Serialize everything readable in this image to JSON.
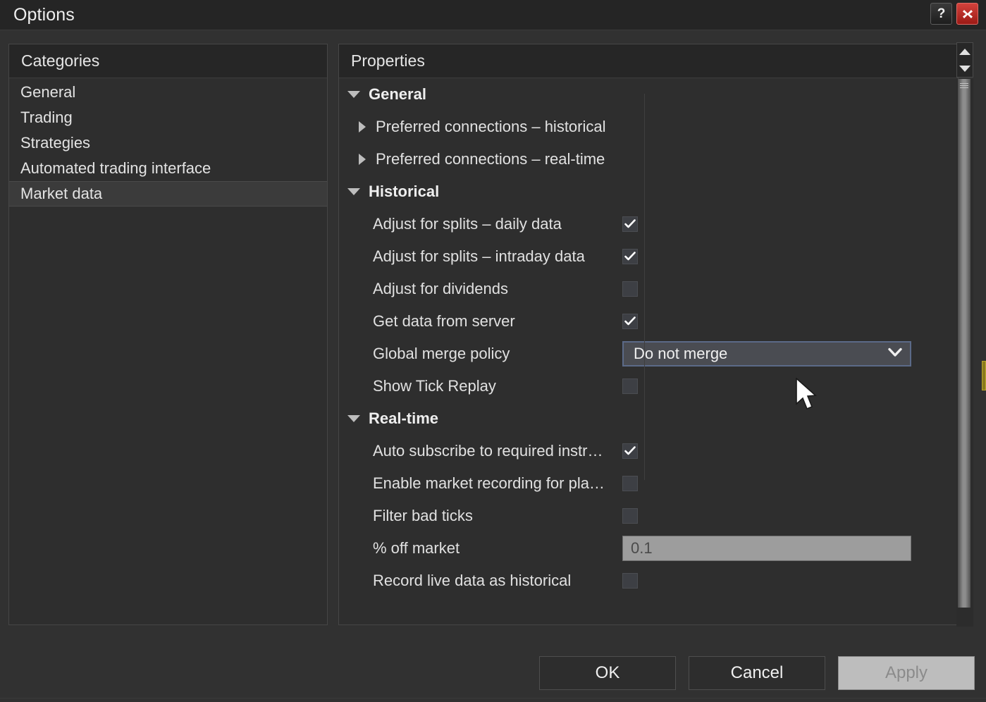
{
  "window": {
    "title": "Options",
    "help_button": "?",
    "help_icon": "question-mark-icon",
    "close_icon": "close-x-icon"
  },
  "categories": {
    "header": "Categories",
    "items": [
      {
        "label": "General",
        "selected": false
      },
      {
        "label": "Trading",
        "selected": false
      },
      {
        "label": "Strategies",
        "selected": false
      },
      {
        "label": "Automated trading interface",
        "selected": false
      },
      {
        "label": "Market data",
        "selected": true
      }
    ]
  },
  "properties": {
    "header": "Properties",
    "groups": [
      {
        "label": "General",
        "expanded": true,
        "subgroups": [
          {
            "label": "Preferred connections – historical",
            "expanded": false
          },
          {
            "label": "Preferred connections – real-time",
            "expanded": false
          }
        ],
        "rows": []
      },
      {
        "label": "Historical",
        "expanded": true,
        "subgroups": [],
        "rows": [
          {
            "label": "Adjust for splits – daily data",
            "control": "checkbox",
            "checked": true
          },
          {
            "label": "Adjust for splits – intraday data",
            "control": "checkbox",
            "checked": true
          },
          {
            "label": "Adjust for dividends",
            "control": "checkbox",
            "checked": false
          },
          {
            "label": "Get data from server",
            "control": "checkbox",
            "checked": true
          },
          {
            "label": "Global merge policy",
            "control": "combo",
            "value": "Do not merge",
            "focused": true
          },
          {
            "label": "Show Tick Replay",
            "control": "checkbox",
            "checked": false
          }
        ]
      },
      {
        "label": "Real-time",
        "expanded": true,
        "subgroups": [],
        "rows": [
          {
            "label": "Auto subscribe to required instr…",
            "control": "checkbox",
            "checked": true
          },
          {
            "label": "Enable market recording for pla…",
            "control": "checkbox",
            "checked": false
          },
          {
            "label": "Filter bad ticks",
            "control": "checkbox",
            "checked": false
          },
          {
            "label": "% off market",
            "control": "text",
            "value": "0.1"
          },
          {
            "label": "Record live data as historical",
            "control": "checkbox",
            "checked": false
          }
        ]
      }
    ]
  },
  "scrollbar": {
    "up_icon": "scroll-up-arrow-icon",
    "down_icon": "scroll-down-arrow-icon"
  },
  "footer": {
    "ok": "OK",
    "cancel": "Cancel",
    "apply": "Apply"
  },
  "colors": {
    "window_background": "#313131",
    "panel_background": "#2e2e2e",
    "titlebar_background": "#252525",
    "close_red": "#c0392f",
    "combo_focus_border": "#5b6a88",
    "text_primary": "#e8e8e8",
    "textfield_background": "#9d9d9d",
    "apply_highlight": "#bdbdbd"
  }
}
